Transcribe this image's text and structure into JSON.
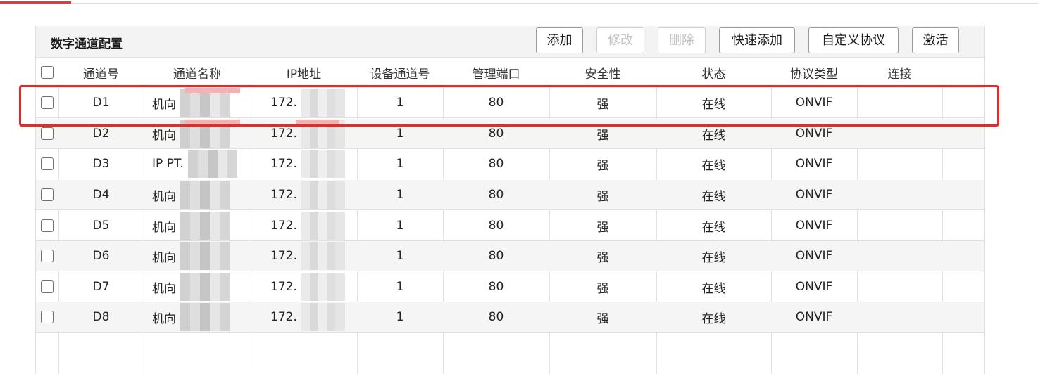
{
  "panel": {
    "title": "数字通道配置"
  },
  "toolbar": {
    "add": "添加",
    "modify": "修改",
    "delete": "删除",
    "quick_add": "快速添加",
    "custom_protocol": "自定义协议",
    "activate": "激活"
  },
  "columns": {
    "channel_no": "通道号",
    "channel_name": "通道名称",
    "ip": "IP地址",
    "device_channel": "设备通道号",
    "mgmt_port": "管理端口",
    "security": "安全性",
    "status": "状态",
    "protocol": "协议类型",
    "connect": "连接"
  },
  "rows": [
    {
      "channel_no": "D1",
      "name": "机向",
      "ip": "172.",
      "device_channel": "1",
      "port": "80",
      "security": "强",
      "status": "在线",
      "protocol": "ONVIF"
    },
    {
      "channel_no": "D2",
      "name": "机向",
      "ip": "172.",
      "device_channel": "1",
      "port": "80",
      "security": "强",
      "status": "在线",
      "protocol": "ONVIF"
    },
    {
      "channel_no": "D3",
      "name": "IP PT.",
      "ip": "172.",
      "device_channel": "1",
      "port": "80",
      "security": "强",
      "status": "在线",
      "protocol": "ONVIF"
    },
    {
      "channel_no": "D4",
      "name": "机向",
      "ip": "172.",
      "device_channel": "1",
      "port": "80",
      "security": "强",
      "status": "在线",
      "protocol": "ONVIF"
    },
    {
      "channel_no": "D5",
      "name": "机向",
      "ip": "172.",
      "device_channel": "1",
      "port": "80",
      "security": "强",
      "status": "在线",
      "protocol": "ONVIF"
    },
    {
      "channel_no": "D6",
      "name": "机向",
      "ip": "172.",
      "device_channel": "1",
      "port": "80",
      "security": "强",
      "status": "在线",
      "protocol": "ONVIF"
    },
    {
      "channel_no": "D7",
      "name": "机向",
      "ip": "172.",
      "device_channel": "1",
      "port": "80",
      "security": "强",
      "status": "在线",
      "protocol": "ONVIF"
    },
    {
      "channel_no": "D8",
      "name": "机向",
      "ip": "172.",
      "device_channel": "1",
      "port": "80",
      "security": "强",
      "status": "在线",
      "protocol": "ONVIF"
    }
  ],
  "colors": {
    "accent": "#e03a3a",
    "highlight": "#e42b2b"
  },
  "icons": {
    "checkbox": "checkbox-icon"
  }
}
